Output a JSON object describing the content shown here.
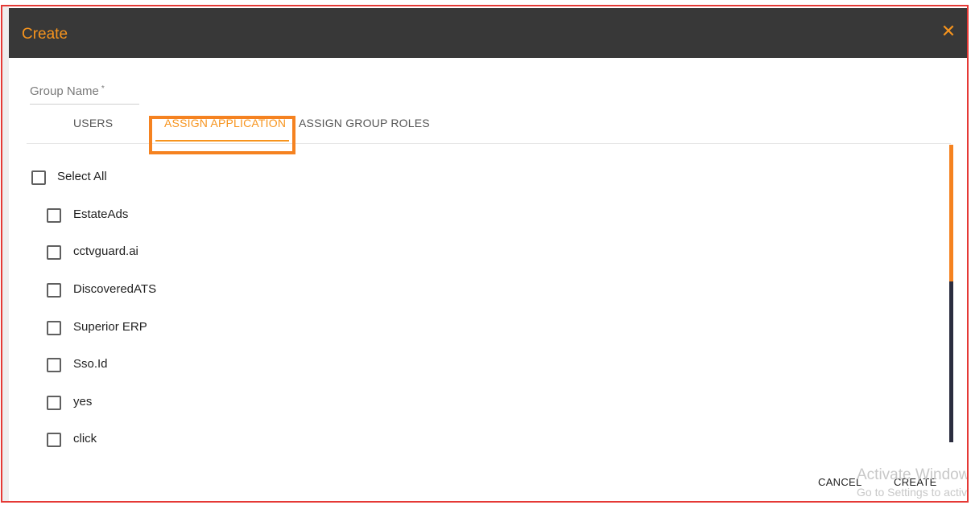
{
  "dialog": {
    "title": "Create"
  },
  "form": {
    "group_name_label": "Group Name",
    "required_mark": "*"
  },
  "tabs": [
    {
      "label": "USERS",
      "active": false
    },
    {
      "label": "ASSIGN APPLICATION",
      "active": true
    },
    {
      "label": "ASSIGN GROUP ROLES",
      "active": false
    }
  ],
  "select_all": {
    "label": "Select All",
    "checked": false
  },
  "applications": [
    {
      "label": "EstateAds",
      "checked": false
    },
    {
      "label": "cctvguard.ai",
      "checked": false
    },
    {
      "label": "DiscoveredATS",
      "checked": false
    },
    {
      "label": "Superior ERP",
      "checked": false
    },
    {
      "label": "Sso.Id",
      "checked": false
    },
    {
      "label": "yes",
      "checked": false
    },
    {
      "label": "click",
      "checked": false
    }
  ],
  "buttons": {
    "cancel": "CANCEL",
    "create": "CREATE"
  },
  "watermark": {
    "line1": "Activate Windows",
    "line2": "Go to Settings to activate Windows."
  },
  "colors": {
    "accent": "#f7941d",
    "header_bg": "#383838",
    "highlight": "#f58220",
    "frame_border": "#e53935",
    "scroll_track": "#2b2d3f"
  },
  "icons": {
    "close": "close-icon",
    "checkbox": "checkbox-unchecked-icon"
  }
}
